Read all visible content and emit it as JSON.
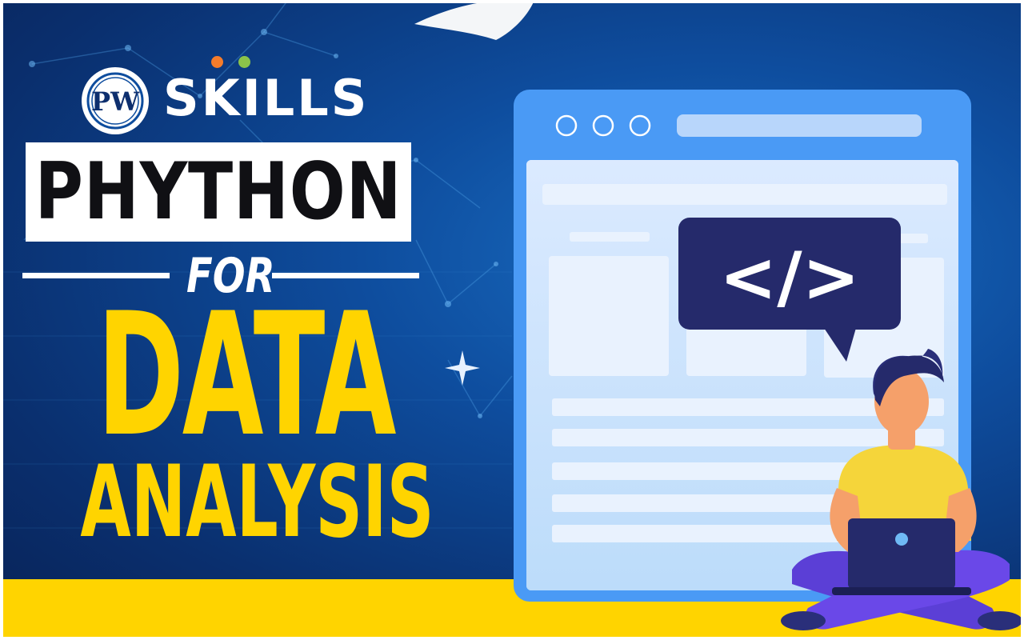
{
  "brand": {
    "logo_word": "SKILLS",
    "logo_emblem_text": "PW",
    "dot_colors": [
      "#f57c2b",
      "#8bc34a"
    ]
  },
  "headline": {
    "line1": "PHYTHON",
    "connector": "FOR",
    "line2": "DATA",
    "line3": "ANALYSIS"
  },
  "code_bubble": {
    "symbol": "</>"
  },
  "colors": {
    "accent_yellow": "#ffd400",
    "background_blue": "#0e4d9e",
    "window_blue": "#4a9af5",
    "bubble_navy": "#252a6b"
  }
}
